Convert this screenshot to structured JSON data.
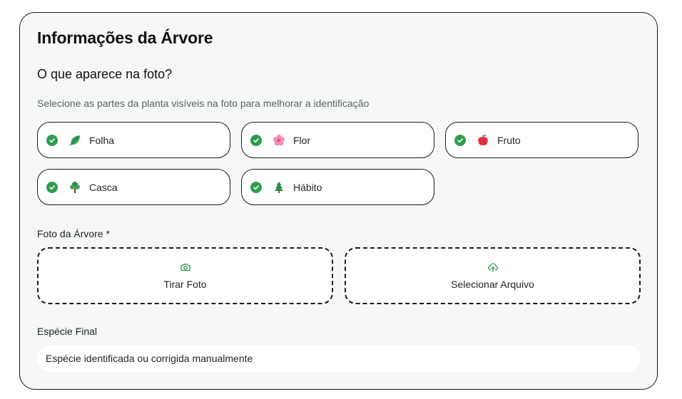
{
  "form": {
    "title": "Informações da Árvore",
    "subtitle": "O que aparece na foto?",
    "description": "Selecione as partes da planta visíveis na foto para melhorar a identificação"
  },
  "parts": [
    {
      "label": "Folha",
      "icon": "leaf-icon",
      "checked": true
    },
    {
      "label": "Flor",
      "icon": "flower-icon",
      "checked": true
    },
    {
      "label": "Fruto",
      "icon": "apple-icon",
      "checked": true
    },
    {
      "label": "Casca",
      "icon": "tree-icon",
      "checked": true
    },
    {
      "label": "Hábito",
      "icon": "pine-tree-icon",
      "checked": true
    }
  ],
  "photo": {
    "label": "Foto da Árvore *",
    "take_photo_label": "Tirar Foto",
    "select_file_label": "Selecionar Arquivo"
  },
  "species": {
    "label": "Espécie Final",
    "placeholder": "Espécie identificada ou corrigida manualmente",
    "value": ""
  },
  "colors": {
    "accent_green": "#2e9d4c",
    "card_background": "#f6f7f7"
  }
}
